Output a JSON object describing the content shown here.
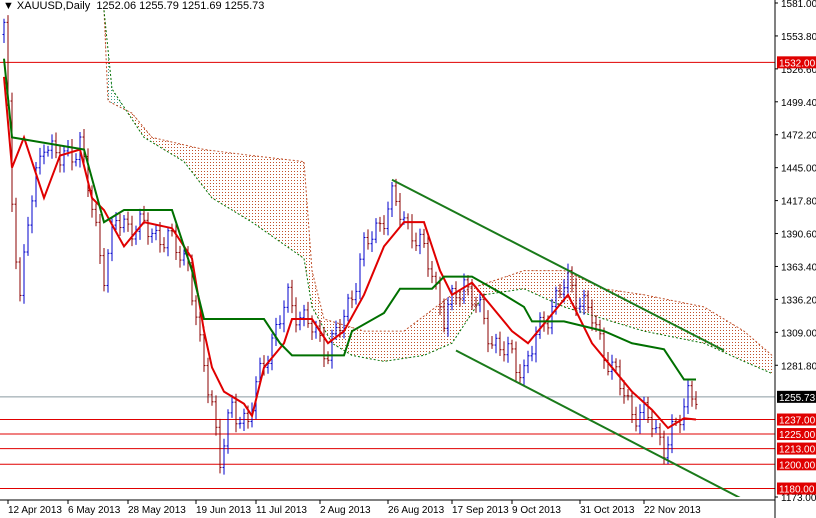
{
  "header": {
    "symbol": "XAUUSD,Daily",
    "open": "1252.06",
    "high": "1255.79",
    "low": "1251.69",
    "close": "1255.73"
  },
  "chart_data": {
    "type": "candlestick",
    "title": "XAUUSD,Daily",
    "ylim": [
      1173.0,
      1581.0
    ],
    "y_ticks": [
      "1581.00",
      "1553.80",
      "1526.60",
      "1499.40",
      "1472.20",
      "1445.00",
      "1417.80",
      "1390.60",
      "1363.40",
      "1336.20",
      "1309.00",
      "1281.80",
      "1255.73",
      "1173.00"
    ],
    "x_ticks": [
      "12 Apr 2013",
      "6 May 2013",
      "28 May 2013",
      "19 Jun 2013",
      "11 Jul 2013",
      "2 Aug 2013",
      "26 Aug 2013",
      "17 Sep 2013",
      "9 Oct 2013",
      "31 Oct 2013",
      "22 Nov 2013"
    ],
    "x_tick_bars": [
      6,
      21,
      36,
      53,
      68,
      84,
      101,
      117,
      132,
      149,
      165
    ],
    "current_price": "1255.73",
    "levels": [
      {
        "label": "1532.00",
        "value": 1532.0
      },
      {
        "label": "1237.00",
        "value": 1237.0
      },
      {
        "label": "1225.00",
        "value": 1225.0
      },
      {
        "label": "1213.00",
        "value": 1213.0
      },
      {
        "label": "1200.00",
        "value": 1200.0
      },
      {
        "label": "1180.00",
        "value": 1180.0
      }
    ],
    "close_keypoints_bar_price": [
      [
        0,
        1560
      ],
      [
        2,
        1418
      ],
      [
        4,
        1340
      ],
      [
        6,
        1400
      ],
      [
        10,
        1470
      ],
      [
        14,
        1450
      ],
      [
        19,
        1465
      ],
      [
        22,
        1410
      ],
      [
        25,
        1360
      ],
      [
        28,
        1400
      ],
      [
        35,
        1395
      ],
      [
        41,
        1385
      ],
      [
        46,
        1368
      ],
      [
        49,
        1294
      ],
      [
        52,
        1253
      ],
      [
        54,
        1203
      ],
      [
        57,
        1245
      ],
      [
        61,
        1236
      ],
      [
        65,
        1286
      ],
      [
        71,
        1336
      ],
      [
        75,
        1320
      ],
      [
        81,
        1294
      ],
      [
        85,
        1320
      ],
      [
        90,
        1377
      ],
      [
        97,
        1418
      ],
      [
        102,
        1393
      ],
      [
        107,
        1360
      ],
      [
        110,
        1320
      ],
      [
        115,
        1352
      ],
      [
        122,
        1303
      ],
      [
        130,
        1278
      ],
      [
        135,
        1320
      ],
      [
        141,
        1352
      ],
      [
        147,
        1320
      ],
      [
        152,
        1278
      ],
      [
        157,
        1245
      ],
      [
        162,
        1235
      ],
      [
        165,
        1215
      ],
      [
        168,
        1228
      ],
      [
        171,
        1262
      ],
      [
        173,
        1256
      ]
    ],
    "tenkan_sen": [
      [
        0,
        1520
      ],
      [
        2,
        1445
      ],
      [
        5,
        1470
      ],
      [
        10,
        1420
      ],
      [
        14,
        1455
      ],
      [
        19,
        1460
      ],
      [
        22,
        1420
      ],
      [
        25,
        1410
      ],
      [
        30,
        1380
      ],
      [
        35,
        1400
      ],
      [
        42,
        1395
      ],
      [
        47,
        1370
      ],
      [
        50,
        1310
      ],
      [
        52,
        1280
      ],
      [
        55,
        1260
      ],
      [
        60,
        1250
      ],
      [
        62,
        1240
      ],
      [
        65,
        1280
      ],
      [
        70,
        1300
      ],
      [
        72,
        1320
      ],
      [
        77,
        1320
      ],
      [
        81,
        1300
      ],
      [
        85,
        1310
      ],
      [
        90,
        1340
      ],
      [
        95,
        1380
      ],
      [
        100,
        1400
      ],
      [
        105,
        1400
      ],
      [
        109,
        1360
      ],
      [
        112,
        1340
      ],
      [
        117,
        1350
      ],
      [
        122,
        1330
      ],
      [
        127,
        1310
      ],
      [
        131,
        1300
      ],
      [
        136,
        1320
      ],
      [
        141,
        1340
      ],
      [
        144,
        1320
      ],
      [
        147,
        1300
      ],
      [
        152,
        1280
      ],
      [
        157,
        1260
      ],
      [
        162,
        1245
      ],
      [
        166,
        1230
      ],
      [
        170,
        1238
      ],
      [
        173,
        1237
      ]
    ],
    "kijun_sen": [
      [
        0,
        1535
      ],
      [
        2,
        1470
      ],
      [
        20,
        1460
      ],
      [
        25,
        1400
      ],
      [
        30,
        1410
      ],
      [
        42,
        1410
      ],
      [
        47,
        1360
      ],
      [
        50,
        1320
      ],
      [
        65,
        1320
      ],
      [
        69,
        1300
      ],
      [
        72,
        1290
      ],
      [
        85,
        1290
      ],
      [
        87,
        1310
      ],
      [
        95,
        1325
      ],
      [
        99,
        1345
      ],
      [
        107,
        1345
      ],
      [
        110,
        1355
      ],
      [
        117,
        1355
      ],
      [
        125,
        1340
      ],
      [
        130,
        1330
      ],
      [
        132,
        1318
      ],
      [
        140,
        1318
      ],
      [
        150,
        1310
      ],
      [
        157,
        1300
      ],
      [
        165,
        1295
      ],
      [
        170,
        1270
      ],
      [
        173,
        1270
      ]
    ],
    "senkou_span_a": [
      [
        25,
        1575
      ],
      [
        26,
        1500
      ],
      [
        32,
        1490
      ],
      [
        37,
        1470
      ],
      [
        50,
        1460
      ],
      [
        62,
        1455
      ],
      [
        75,
        1450
      ],
      [
        77,
        1360
      ],
      [
        80,
        1320
      ],
      [
        90,
        1310
      ],
      [
        100,
        1310
      ],
      [
        112,
        1340
      ],
      [
        130,
        1360
      ],
      [
        140,
        1360
      ],
      [
        150,
        1345
      ],
      [
        160,
        1340
      ],
      [
        175,
        1330
      ],
      [
        185,
        1310
      ],
      [
        192,
        1290
      ]
    ],
    "senkou_span_b": [
      [
        25,
        1575
      ],
      [
        27,
        1510
      ],
      [
        35,
        1470
      ],
      [
        45,
        1450
      ],
      [
        52,
        1420
      ],
      [
        62,
        1400
      ],
      [
        75,
        1370
      ],
      [
        77,
        1330
      ],
      [
        82,
        1300
      ],
      [
        87,
        1290
      ],
      [
        95,
        1285
      ],
      [
        105,
        1290
      ],
      [
        112,
        1300
      ],
      [
        120,
        1340
      ],
      [
        130,
        1345
      ],
      [
        140,
        1330
      ],
      [
        150,
        1320
      ],
      [
        160,
        1310
      ],
      [
        175,
        1300
      ],
      [
        185,
        1285
      ],
      [
        192,
        1275
      ]
    ],
    "channel_upper": [
      [
        97,
        1435
      ],
      [
        180,
        1294
      ]
    ],
    "channel_lower": [
      [
        113,
        1294
      ],
      [
        190,
        1162
      ]
    ],
    "colors": {
      "bull": "#0000cc",
      "bear": "#8b0000",
      "tenkan": "#e00000",
      "kijun": "#007000",
      "cloud_bear": "#c0502a",
      "cloud_bull": "#3a9a8a",
      "channel": "#1a7a1a",
      "level": "#e00000"
    }
  }
}
